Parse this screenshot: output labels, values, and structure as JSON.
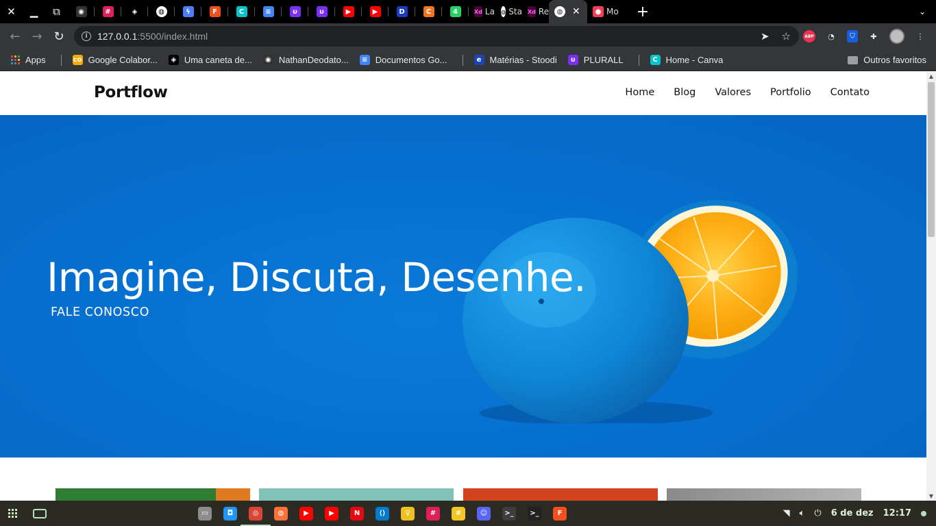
{
  "browser": {
    "tabs": [
      {
        "icon": "github-icon",
        "color": "#333333",
        "glyph": "◉"
      },
      {
        "icon": "slack-icon",
        "color": "#e01e5a",
        "glyph": "#"
      },
      {
        "icon": "codepen-icon",
        "color": "#000000",
        "glyph": "◈"
      },
      {
        "icon": "globe-icon",
        "color": "#ffffff",
        "glyph": "◍"
      },
      {
        "icon": "messenger-icon",
        "color": "#4a7dff",
        "glyph": "ϟ"
      },
      {
        "icon": "figma-icon",
        "color": "#f24e1e",
        "glyph": "F"
      },
      {
        "icon": "canva-icon",
        "color": "#00c4cc",
        "glyph": "C"
      },
      {
        "icon": "google-docs-icon",
        "color": "#4285f4",
        "glyph": "≡"
      },
      {
        "icon": "plurall-icon",
        "color": "#7b2ff7",
        "glyph": "υ"
      },
      {
        "icon": "plurall-icon",
        "color": "#7b2ff7",
        "glyph": "υ"
      },
      {
        "icon": "youtube-music-icon",
        "color": "#ff0000",
        "glyph": "▶"
      },
      {
        "icon": "youtube-icon",
        "color": "#ff0000",
        "glyph": "▶"
      },
      {
        "icon": "disney-plus-icon",
        "color": "#1a3dbf",
        "glyph": "D"
      },
      {
        "icon": "crunchyroll-icon",
        "color": "#f47521",
        "glyph": "C"
      },
      {
        "icon": "whatsapp-icon",
        "color": "#25d366",
        "glyph": "4"
      }
    ],
    "named_tabs": [
      {
        "icon": "xd-icon",
        "color": "#470137",
        "glyph": "Xd",
        "label": "Lar"
      },
      {
        "icon": "globe-icon",
        "color": "#ffffff",
        "glyph": "◍",
        "label": "Sta"
      },
      {
        "icon": "xd-icon",
        "color": "#470137",
        "glyph": "Xd",
        "label": "Re"
      }
    ],
    "active_tab": {
      "icon": "globe-icon",
      "close": "✕"
    },
    "last_tab": {
      "icon": "monday-icon",
      "label": "Mo"
    },
    "new_tab": "+",
    "tab_dropdown": "⌄",
    "url_host": "127.0.0.1",
    "url_path": ":5500/index.html"
  },
  "bookmarks": [
    {
      "icon": "apps-icon",
      "label": "Apps"
    },
    {
      "icon": "colab-icon",
      "color": "#f9ab00",
      "glyph": "co",
      "label": "Google Colabor..."
    },
    {
      "icon": "codepen-icon",
      "color": "#000000",
      "glyph": "◈",
      "label": "Uma caneta de..."
    },
    {
      "icon": "github-icon",
      "color": "#333333",
      "glyph": "◉",
      "label": "NathanDeodato..."
    },
    {
      "icon": "google-docs-icon",
      "color": "#4285f4",
      "glyph": "≡",
      "label": "Documentos Go..."
    },
    {
      "icon": "stoodi-icon",
      "color": "#1a47b8",
      "glyph": "e",
      "label": "Matérias - Stoodi"
    },
    {
      "icon": "plurall-icon",
      "color": "#7b2ff7",
      "glyph": "υ",
      "label": "PLURALL"
    },
    {
      "icon": "canva-icon",
      "color": "#00c4cc",
      "glyph": "C",
      "label": "Home - Canva"
    }
  ],
  "bookmarks_other": "Outros favoritos",
  "site": {
    "logo": "Portflow",
    "nav": [
      "Home",
      "Blog",
      "Valores",
      "Portfolio",
      "Contato"
    ],
    "hero_title": "Imagine, Discuta, Desenhe.",
    "hero_cta": "FALE CONOSCO",
    "hero_color": "#0670cf",
    "cards": [
      {
        "color": "#2e7d32"
      },
      {
        "color": "#80c2b8"
      },
      {
        "color": "#d2431e"
      },
      {
        "color": "#9a9a9a"
      }
    ]
  },
  "taskbar": {
    "apps": [
      {
        "icon": "files-icon",
        "color": "#8d8d8d",
        "glyph": "▭"
      },
      {
        "icon": "store-icon",
        "color": "#2196f3",
        "glyph": "◘"
      },
      {
        "icon": "chrome-icon",
        "color": "#db4437",
        "glyph": "◎",
        "active": true
      },
      {
        "icon": "firefox-icon",
        "color": "#ff7139",
        "glyph": "◍"
      },
      {
        "icon": "youtube-icon",
        "color": "#ff0000",
        "glyph": "▶"
      },
      {
        "icon": "youtube-music-icon",
        "color": "#ff0000",
        "glyph": "▶"
      },
      {
        "icon": "netflix-icon",
        "color": "#e50914",
        "glyph": "N"
      },
      {
        "icon": "vscode-icon",
        "color": "#007acc",
        "glyph": "⟨⟩"
      },
      {
        "icon": "idea-icon",
        "color": "#f0c020",
        "glyph": "♀"
      },
      {
        "icon": "slack-icon",
        "color": "#e01e5a",
        "glyph": "#"
      },
      {
        "icon": "notes-icon",
        "color": "#f3c623",
        "glyph": "#"
      },
      {
        "icon": "discord-icon",
        "color": "#5865f2",
        "glyph": "☺"
      },
      {
        "icon": "terminal-icon",
        "color": "#3d3d3d",
        "glyph": ">_"
      },
      {
        "icon": "terminal-icon",
        "color": "#222222",
        "glyph": ">_"
      },
      {
        "icon": "figma-icon",
        "color": "#f24e1e",
        "glyph": "F"
      }
    ],
    "date": "6 de dez",
    "time": "12:17"
  }
}
